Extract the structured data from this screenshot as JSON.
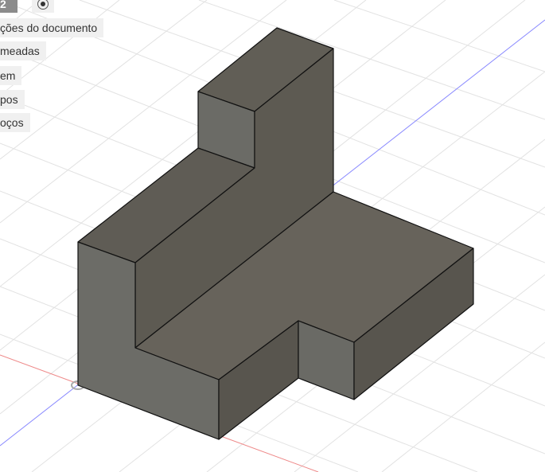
{
  "browser": {
    "document_title": "2 v1",
    "items": [
      {
        "label": "ções do documento"
      },
      {
        "label": "meadas"
      },
      {
        "label": "em"
      },
      {
        "label": "pos"
      },
      {
        "label": "oços"
      }
    ]
  },
  "colors": {
    "x_axis": "#e06060",
    "z_axis": "#7070e8",
    "model": "#66625a"
  }
}
